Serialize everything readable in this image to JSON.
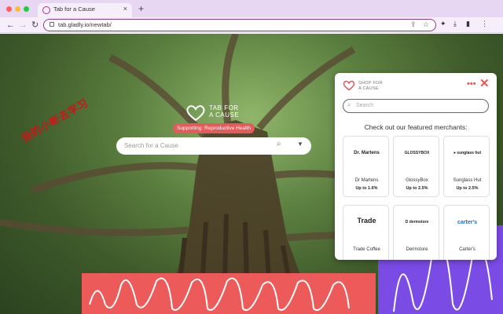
{
  "browser": {
    "tab_title": "Tab for a Cause",
    "tab_close": "×",
    "new_tab": "+",
    "url": "tab.gladly.io/newtab/",
    "window_colors": [
      "#ff5f57",
      "#febc2e",
      "#28c840"
    ]
  },
  "page": {
    "logo_line1": "TAB FOR",
    "logo_line2": "A CAUSE",
    "support_text": "Supporting: Reproductive Health",
    "search_placeholder": "Search for a Cause",
    "watermark": "我的小新去学习",
    "accent_coral": "#ec5a5a",
    "accent_purple": "#7b4be6"
  },
  "popup": {
    "brand_line1": "SHOP FOR",
    "brand_line2": "A CAUSE",
    "more": "•••",
    "close": "✕",
    "search_placeholder": "Search",
    "heading": "Check out our featured merchants:",
    "merchants": [
      {
        "logo": "Dr. Martens",
        "name": "Dr Martens",
        "cashback": "Up to 1.6%"
      },
      {
        "logo": "GLOSSYBOX",
        "name": "GlossyBox",
        "cashback": "Up to 2.5%"
      },
      {
        "logo": "● sunglass hut",
        "name": "Sunglass Hut",
        "cashback": "Up to 2.5%"
      },
      {
        "logo": "Trade",
        "name": "Trade Coffee",
        "cashback": ""
      },
      {
        "logo": "D dermstore",
        "name": "Dermstore",
        "cashback": ""
      },
      {
        "logo": "carter's",
        "name": "Carter's",
        "cashback": ""
      }
    ]
  }
}
